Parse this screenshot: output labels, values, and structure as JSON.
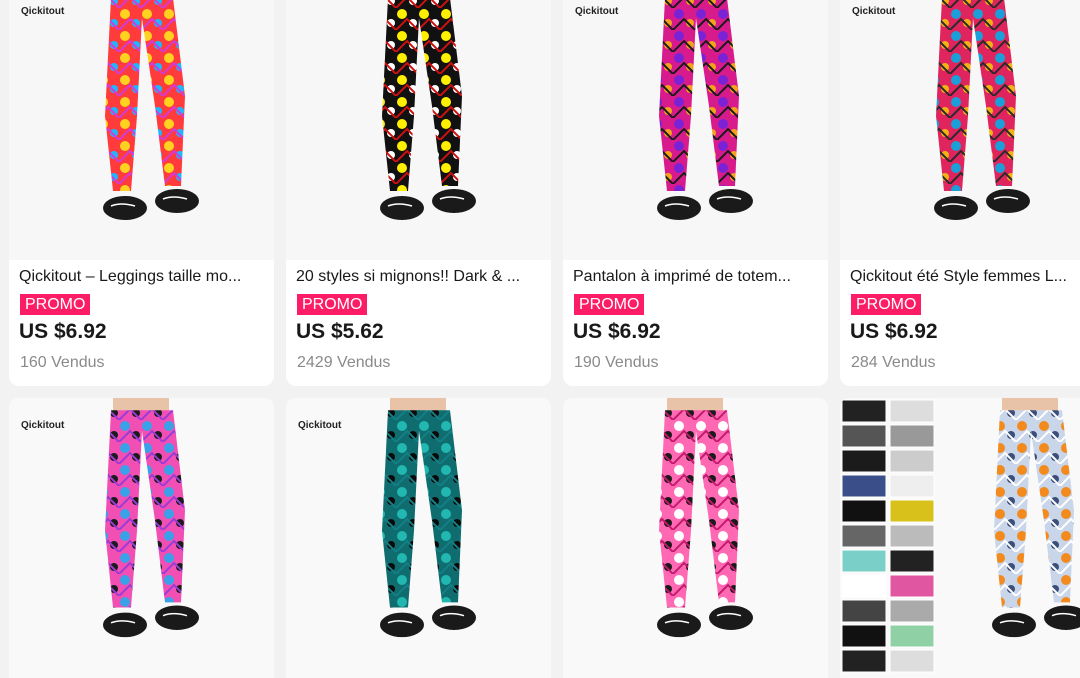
{
  "products": [
    {
      "brand": "Qickitout",
      "title": "Qickitout – Leggings taille mo...",
      "promo": "PROMO",
      "price": "US $6.92",
      "sold": "160 Vendus",
      "colors": [
        "#ff3b3b",
        "#ffd21f",
        "#1fb6ff",
        "#d43ad6"
      ]
    },
    {
      "brand": "",
      "title": "20 styles si mignons!! Dark & ...",
      "promo": "PROMO",
      "price": "US $5.62",
      "sold": "2429 Vendus",
      "colors": [
        "#111111",
        "#ffef00",
        "#ffffff",
        "#cc1111"
      ]
    },
    {
      "brand": "Qickitout",
      "title": "Pantalon à imprimé de totem...",
      "promo": "PROMO",
      "price": "US $6.92",
      "sold": "190 Vendus",
      "colors": [
        "#d81b8c",
        "#7a23d6",
        "#f4a11c",
        "#1a1a1a"
      ]
    },
    {
      "brand": "Qickitout",
      "title": "Qickitout été Style femmes L...",
      "promo": "PROMO",
      "price": "US $6.92",
      "sold": "284 Vendus",
      "colors": [
        "#e0245e",
        "#1b9fd8",
        "#f3b112",
        "#2a2a2a"
      ]
    },
    {
      "brand": "Qickitout",
      "colors": [
        "#f14fb3",
        "#3aa0e8",
        "#1b1b1b",
        "#9b3bd6"
      ]
    },
    {
      "brand": "Qickitout",
      "colors": [
        "#0f6d70",
        "#22b7b0",
        "#0a0a0a",
        "#147f84"
      ]
    },
    {
      "brand": "",
      "colors": [
        "#ff69b4",
        "#ffffff",
        "#1a1a1a",
        "#c21a6c"
      ]
    },
    {
      "brand": "",
      "colors": [
        "#c9d6ea",
        "#f28a1e",
        "#3b4f7a",
        "#ffffff"
      ]
    }
  ]
}
